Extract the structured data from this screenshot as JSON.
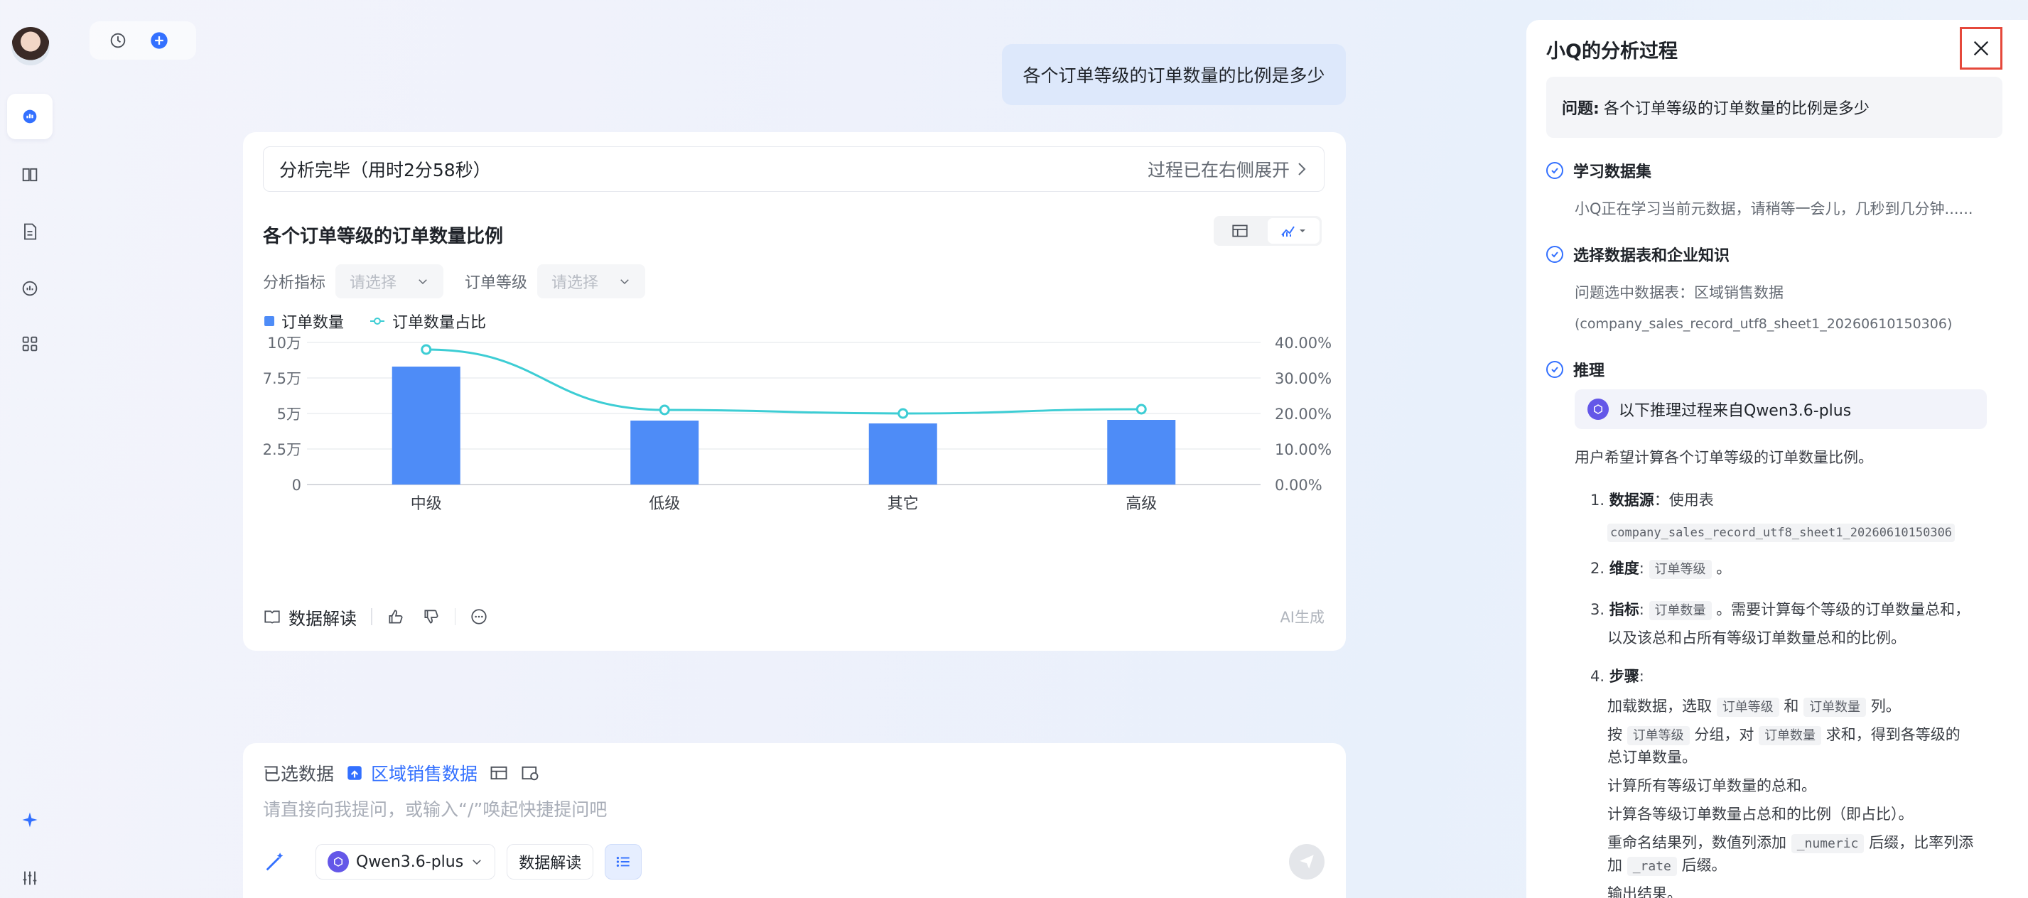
{
  "user_message": "各个订单等级的订单数量的比例是多少",
  "card": {
    "status_left": "分析完毕（用时2分58秒）",
    "status_right": "过程已在右侧展开",
    "chart_title": "各个订单等级的订单数量比例",
    "filter1_label": "分析指标",
    "filter1_placeholder": "请选择",
    "filter2_label": "订单等级",
    "filter2_placeholder": "请选择",
    "interpret_label": "数据解读",
    "ai_tag": "AI生成"
  },
  "chart_data": {
    "type": "bar",
    "categories": [
      "中级",
      "低级",
      "其它",
      "高级"
    ],
    "series": [
      {
        "name": "订单数量",
        "type": "bar",
        "axis": "left",
        "values": [
          83000,
          45000,
          43000,
          45500
        ]
      },
      {
        "name": "订单数量占比",
        "type": "line",
        "axis": "right",
        "values": [
          0.38,
          0.21,
          0.2,
          0.212
        ]
      }
    ],
    "y_left": {
      "ticks": [
        "0",
        "2.5万",
        "5万",
        "7.5万",
        "10万"
      ],
      "range": [
        0,
        100000
      ]
    },
    "y_right": {
      "ticks": [
        "0.00%",
        "10.00%",
        "20.00%",
        "30.00%",
        "40.00%"
      ],
      "range": [
        0,
        0.4
      ]
    },
    "colors": {
      "bar": "#4e8cf7",
      "line": "#3dcdd4"
    },
    "grid": true,
    "legend": "top-left"
  },
  "composer": {
    "selected_label": "已选数据",
    "dataset_name": "区域销售数据",
    "placeholder": "请直接向我提问，或输入“/”唤起快捷提问吧",
    "model": "Qwen3.6-plus",
    "interpret_btn": "数据解读"
  },
  "panel": {
    "title": "小Q的分析过程",
    "question_label": "问题:",
    "question_text": "各个订单等级的订单数量的比例是多少",
    "steps": [
      {
        "title": "学习数据集",
        "body": "小Q正在学习当前元数据，请稍等一会儿，几秒到几分钟......"
      },
      {
        "title": "选择数据表和企业知识",
        "body1": "问题选中数据表：区域销售数据",
        "body2": "(company_sales_record_utf8_sheet1_20260610150306)"
      },
      {
        "title": "推理"
      }
    ],
    "source_chip": "以下推理过程来自Qwen3.6-plus",
    "reason_intro": "用户希望计算各个订单等级的订单数量比例。",
    "items": {
      "i1_num": "1.",
      "i1_key": "数据源",
      "i1_text": "：使用表",
      "i1_code": "company_sales_record_utf8_sheet1_20260610150306",
      "i2_num": "2.",
      "i2_key": "维度",
      "i2_code": "订单等级",
      "i2_tail": "。",
      "i3_num": "3.",
      "i3_key": "指标",
      "i3_code": "订单数量",
      "i3_tail": "。需要计算每个等级的订单数量总和，",
      "i3_line2": "以及该总和占所有等级订单数量总和的比例。",
      "i4_num": "4.",
      "i4_key": "步骤",
      "s1_a": "加载数据，选取",
      "s1_c1": "订单等级",
      "s1_b": "和",
      "s1_c2": "订单数量",
      "s1_d": "列。",
      "s2_a": "按",
      "s2_c1": "订单等级",
      "s2_b": "分组，对",
      "s2_c2": "订单数量",
      "s2_d": "求和，得到各等级的",
      "s2_line2": "总订单数量。",
      "s3": "计算所有等级订单数量的总和。",
      "s4": "计算各等级订单数量占总和的比例（即占比）。",
      "s5_a": "重命名结果列，数值列添加",
      "s5_c1": "_numeric",
      "s5_b": "后缀，比率列添",
      "s5_line2_a": "加",
      "s5_c2": "_rate",
      "s5_line2_b": "后缀。",
      "s6": "输出结果。"
    }
  }
}
